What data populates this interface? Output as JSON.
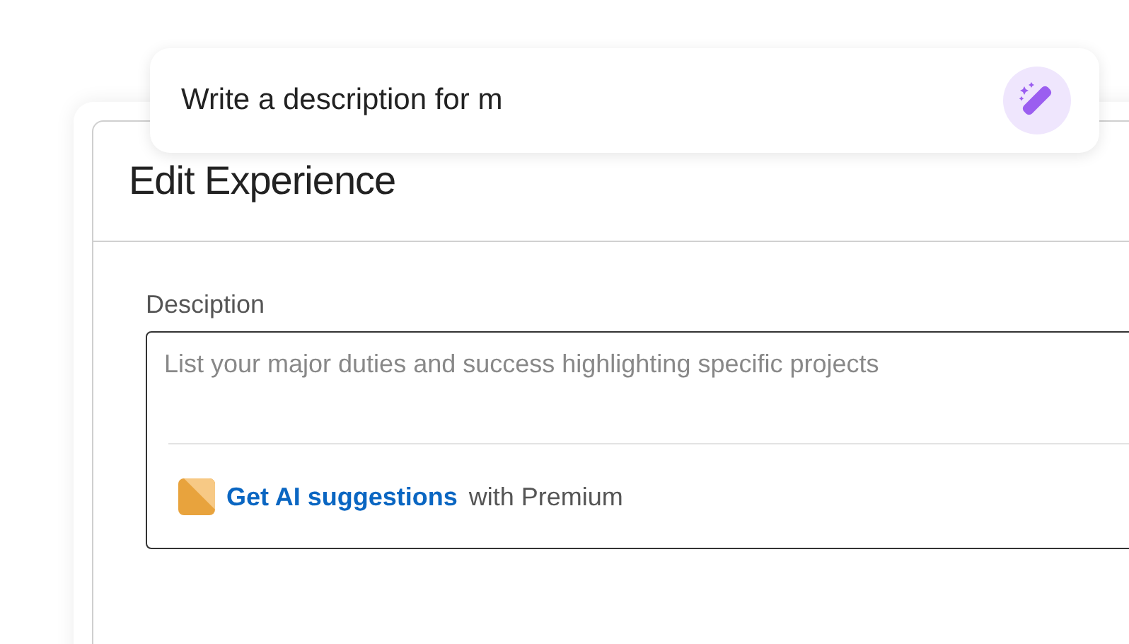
{
  "prompt_bar": {
    "value": "Write a description for m"
  },
  "dialog": {
    "title": "Edit Experience",
    "description_field": {
      "label": "Desciption",
      "placeholder": "List your major duties and success highlighting specific projects"
    },
    "ai_promo": {
      "link": "Get AI suggestions",
      "text": "with Premium"
    }
  }
}
